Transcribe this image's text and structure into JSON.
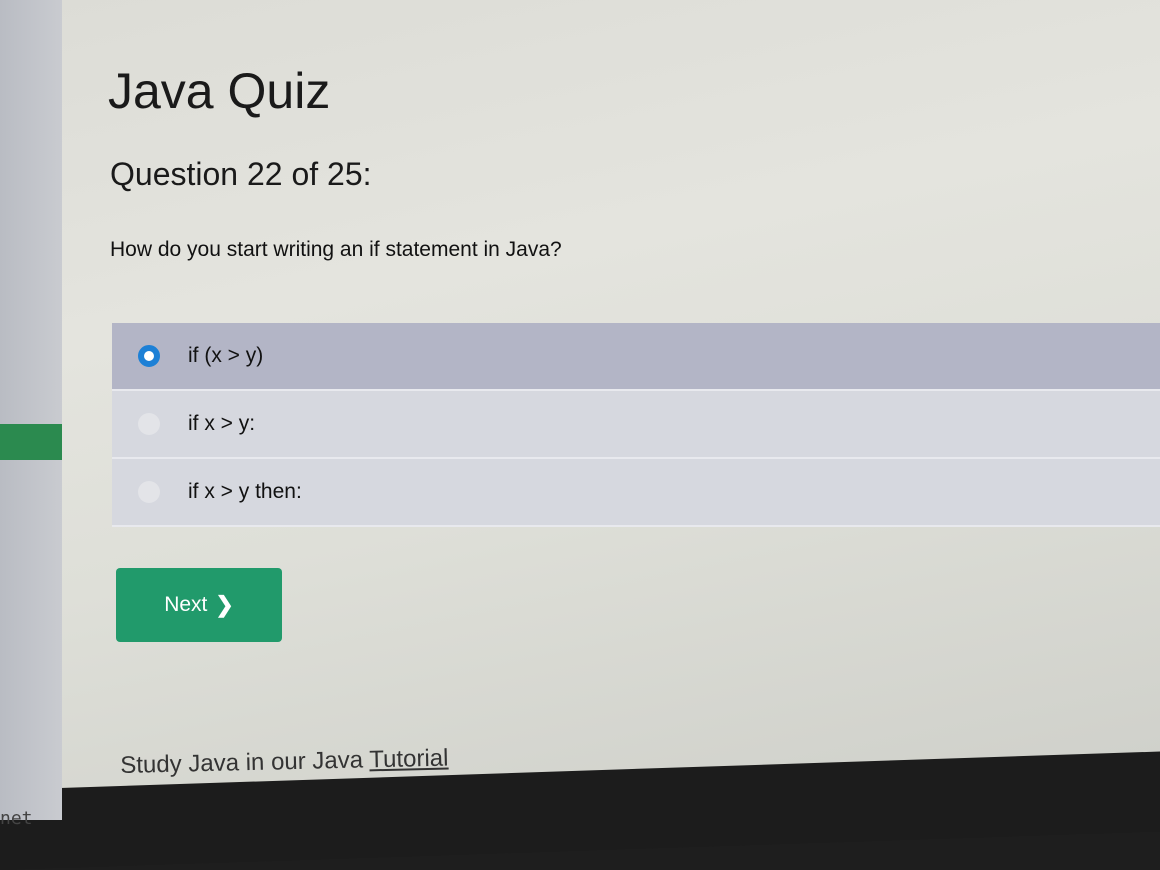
{
  "quiz": {
    "title": "Java Quiz",
    "progress": "Question 22 of 25:",
    "question": "How do you start writing an if statement in Java?",
    "options": [
      {
        "label": "if (x > y)",
        "selected": true
      },
      {
        "label": "if x > y:",
        "selected": false
      },
      {
        "label": "if x > y then:",
        "selected": false
      }
    ],
    "next_label": "Next",
    "next_icon": "chevron-right-icon"
  },
  "footer": {
    "study_text": "Study Java in our Java ",
    "study_link": "Tutorial"
  },
  "sidebar": {
    "fragment": "net"
  },
  "colors": {
    "accent_green": "#219a6b",
    "selected_radio": "#1d80d6",
    "selected_row": "#b3b5c6"
  }
}
